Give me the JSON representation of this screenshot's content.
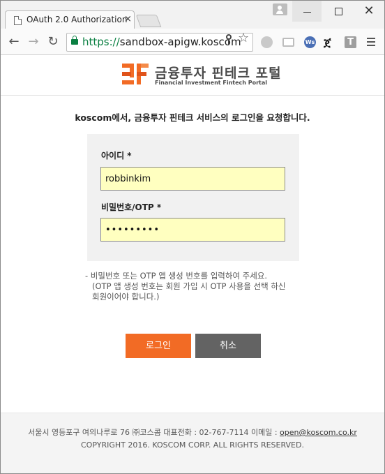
{
  "browser": {
    "tab_title": "OAuth 2.0 Authorization",
    "tab_close": "×",
    "window_close": "✕",
    "url_scheme": "https://",
    "url_host": "sandbox-apigw.koscom",
    "star_glyph": "☆",
    "ext_ws": "Ws",
    "ext_t": "T",
    "ext_glyph": "ጀ",
    "back_glyph": "←",
    "forward_glyph": "→",
    "reload_glyph": "↻"
  },
  "header": {
    "logo_title": "금융투자 핀테크 포털",
    "logo_subtitle": "Financial Investment Fintech Portal",
    "brand_colors": {
      "orange": "#f26b25",
      "dark_orange": "#e0531b"
    }
  },
  "login": {
    "request_message": "koscom에서, 금융투자 핀테크 서비스의 로그인을 요청합니다.",
    "id_label": "아이디 *",
    "id_value": "robbinkim",
    "password_label": "비밀번호/OTP *",
    "password_value": "•••••••••",
    "help_lines": [
      "- 비밀번호 또는 OTP 앱 생성 번호를 입력하여 주세요.",
      "(OTP 앱 생성 번호는 회원 가입 시 OTP 사용을 선택 하신",
      "회원이어야 합니다.)"
    ],
    "login_button": "로그인",
    "cancel_button": "취소"
  },
  "footer": {
    "address_prefix": "서울시 영등포구 여의나루로 76 ㈜코스콤 대표전화 : 02-767-7114 이메일 : ",
    "email": "open@koscom.co.kr",
    "copyright": "COPYRIGHT 2016. KOSCOM CORP. ALL RIGHTS RESERVED."
  }
}
